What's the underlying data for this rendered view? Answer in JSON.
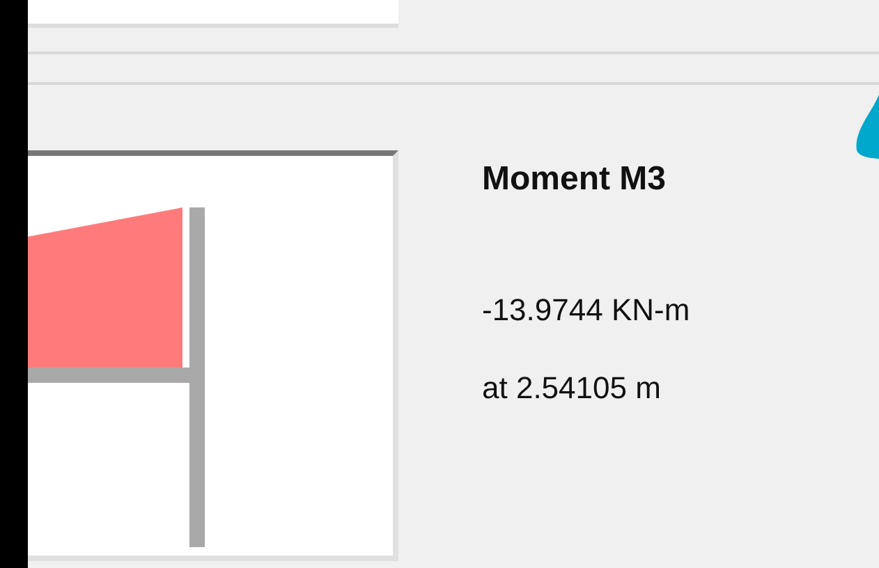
{
  "diagram": {
    "title": "Moment M3",
    "value": "-13.9744 KN-m",
    "location": "at 2.54105 m"
  }
}
